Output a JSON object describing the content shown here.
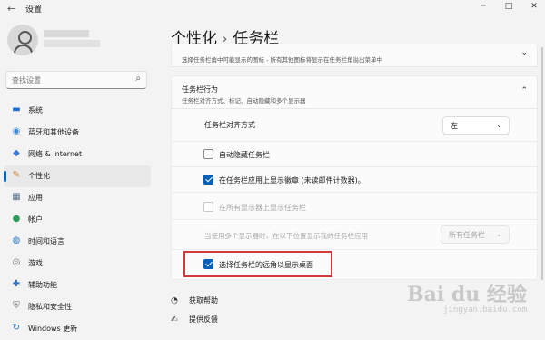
{
  "window": {
    "title": "设置",
    "controls": {
      "minimize": "─",
      "maximize": "□",
      "close": "✕"
    }
  },
  "user": {
    "avatar_icon": "user-avatar-icon"
  },
  "search": {
    "placeholder": "查找设置",
    "icon": "search-icon"
  },
  "sidebar": {
    "items": [
      {
        "label": "系统",
        "icon": "monitor-icon",
        "icon_glyph": "▬",
        "icon_color": "#1e6fd0",
        "active": false
      },
      {
        "label": "蓝牙和其他设备",
        "icon": "bluetooth-icon",
        "icon_glyph": "◉",
        "icon_color": "#3a8ad8",
        "active": false
      },
      {
        "label": "网络 & Internet",
        "icon": "wifi-icon",
        "icon_glyph": "◆",
        "icon_color": "#3a7bd5",
        "active": false
      },
      {
        "label": "个性化",
        "icon": "brush-icon",
        "icon_glyph": "✎",
        "icon_color": "#c77a2a",
        "active": true
      },
      {
        "label": "应用",
        "icon": "apps-icon",
        "icon_glyph": "▦",
        "icon_color": "#5a6f8a",
        "active": false
      },
      {
        "label": "帐户",
        "icon": "account-icon",
        "icon_glyph": "●",
        "icon_color": "#2e9c5a",
        "active": false
      },
      {
        "label": "时间和语言",
        "icon": "globe-clock-icon",
        "icon_glyph": "◍",
        "icon_color": "#2b7fd0",
        "active": false
      },
      {
        "label": "游戏",
        "icon": "gamepad-icon",
        "icon_glyph": "◎",
        "icon_color": "#777777",
        "active": false
      },
      {
        "label": "辅助功能",
        "icon": "accessibility-icon",
        "icon_glyph": "✚",
        "icon_color": "#2f6fc4",
        "active": false
      },
      {
        "label": "隐私和安全性",
        "icon": "shield-icon",
        "icon_glyph": "⛨",
        "icon_color": "#666666",
        "active": false
      },
      {
        "label": "Windows 更新",
        "icon": "update-icon",
        "icon_glyph": "↻",
        "icon_color": "#1e6fd0",
        "active": false
      }
    ],
    "accent_color": "#0067c0"
  },
  "breadcrumb": {
    "parent": "个性化",
    "separator": "›",
    "current": "任务栏"
  },
  "sections": {
    "previous_card_desc": "选择任务栏角中可能显示的图标 - 所有其他图标将显示在任务栏角溢出菜单中",
    "behaviors": {
      "title": "任务栏行为",
      "desc": "任务栏对齐方式、标记、自动隐藏和多个显示器",
      "alignment": {
        "label": "任务栏对齐方式",
        "value": "左"
      },
      "auto_hide": {
        "label": "自动隐藏任务栏",
        "checked": false
      },
      "badges": {
        "label": "在任务栏应用上显示徽章 (未读邮件计数器)。",
        "checked": true
      },
      "all_displays": {
        "label": "在所有显示器上显示任务栏",
        "checked": false,
        "disabled": true
      },
      "multi_display": {
        "label": "当使用多个显示器时，在以下位置显示我的任务栏应用",
        "value": "所有任务栏",
        "disabled": true
      },
      "far_corner": {
        "label": "选择任务栏的远角以显示桌面",
        "checked": true
      }
    }
  },
  "help": {
    "get_help": "获取帮助",
    "feedback": "提供反馈"
  },
  "watermark": {
    "text": "Bai du 经验",
    "sub": "jingyan.baidu.com"
  },
  "colors": {
    "checkbox_checked": "#005fb8",
    "highlight_border": "#d23a3a"
  }
}
